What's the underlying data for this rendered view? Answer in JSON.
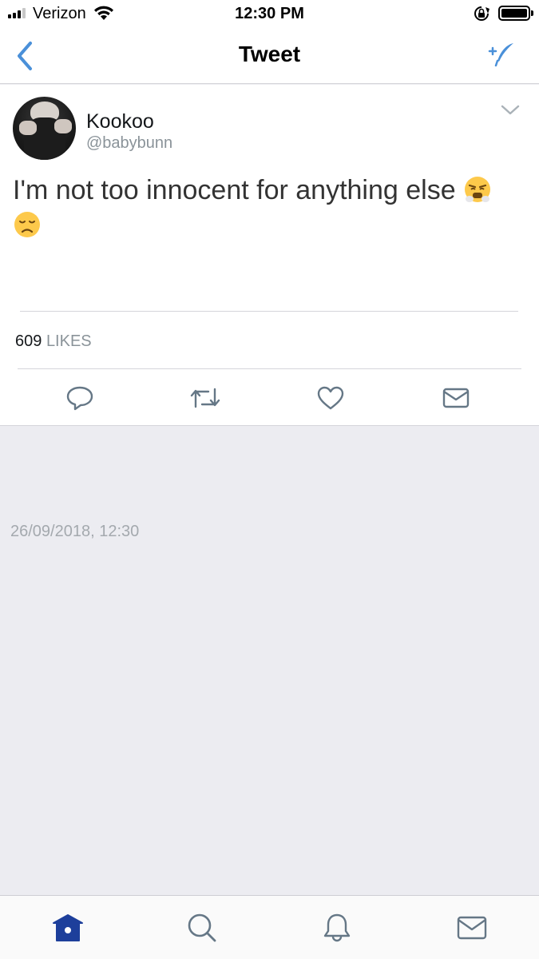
{
  "status_bar": {
    "carrier": "Verizon",
    "time": "12:30 PM",
    "signal_bars_filled": 3,
    "signal_bars_total": 4
  },
  "nav": {
    "title": "Tweet",
    "back_icon": "chevron-left-icon",
    "compose_icon": "compose-feather-icon",
    "accent_color": "#4a90d9"
  },
  "tweet": {
    "display_name": "Kookoo",
    "handle": "@babybunn",
    "text": "I'm not too innocent for anything else",
    "emojis": [
      "face-with-steam-from-nose",
      "disappointed-face"
    ],
    "likes_count": "609",
    "likes_label": "LIKES",
    "actions": [
      "reply-icon",
      "retweet-icon",
      "like-icon",
      "direct-message-icon"
    ]
  },
  "timestamp": "26/09/2018, 12:30",
  "tab_bar": {
    "items": [
      "home-icon",
      "search-icon",
      "notifications-icon",
      "messages-icon"
    ],
    "active": "home-icon",
    "active_color": "#1d3f9b"
  }
}
